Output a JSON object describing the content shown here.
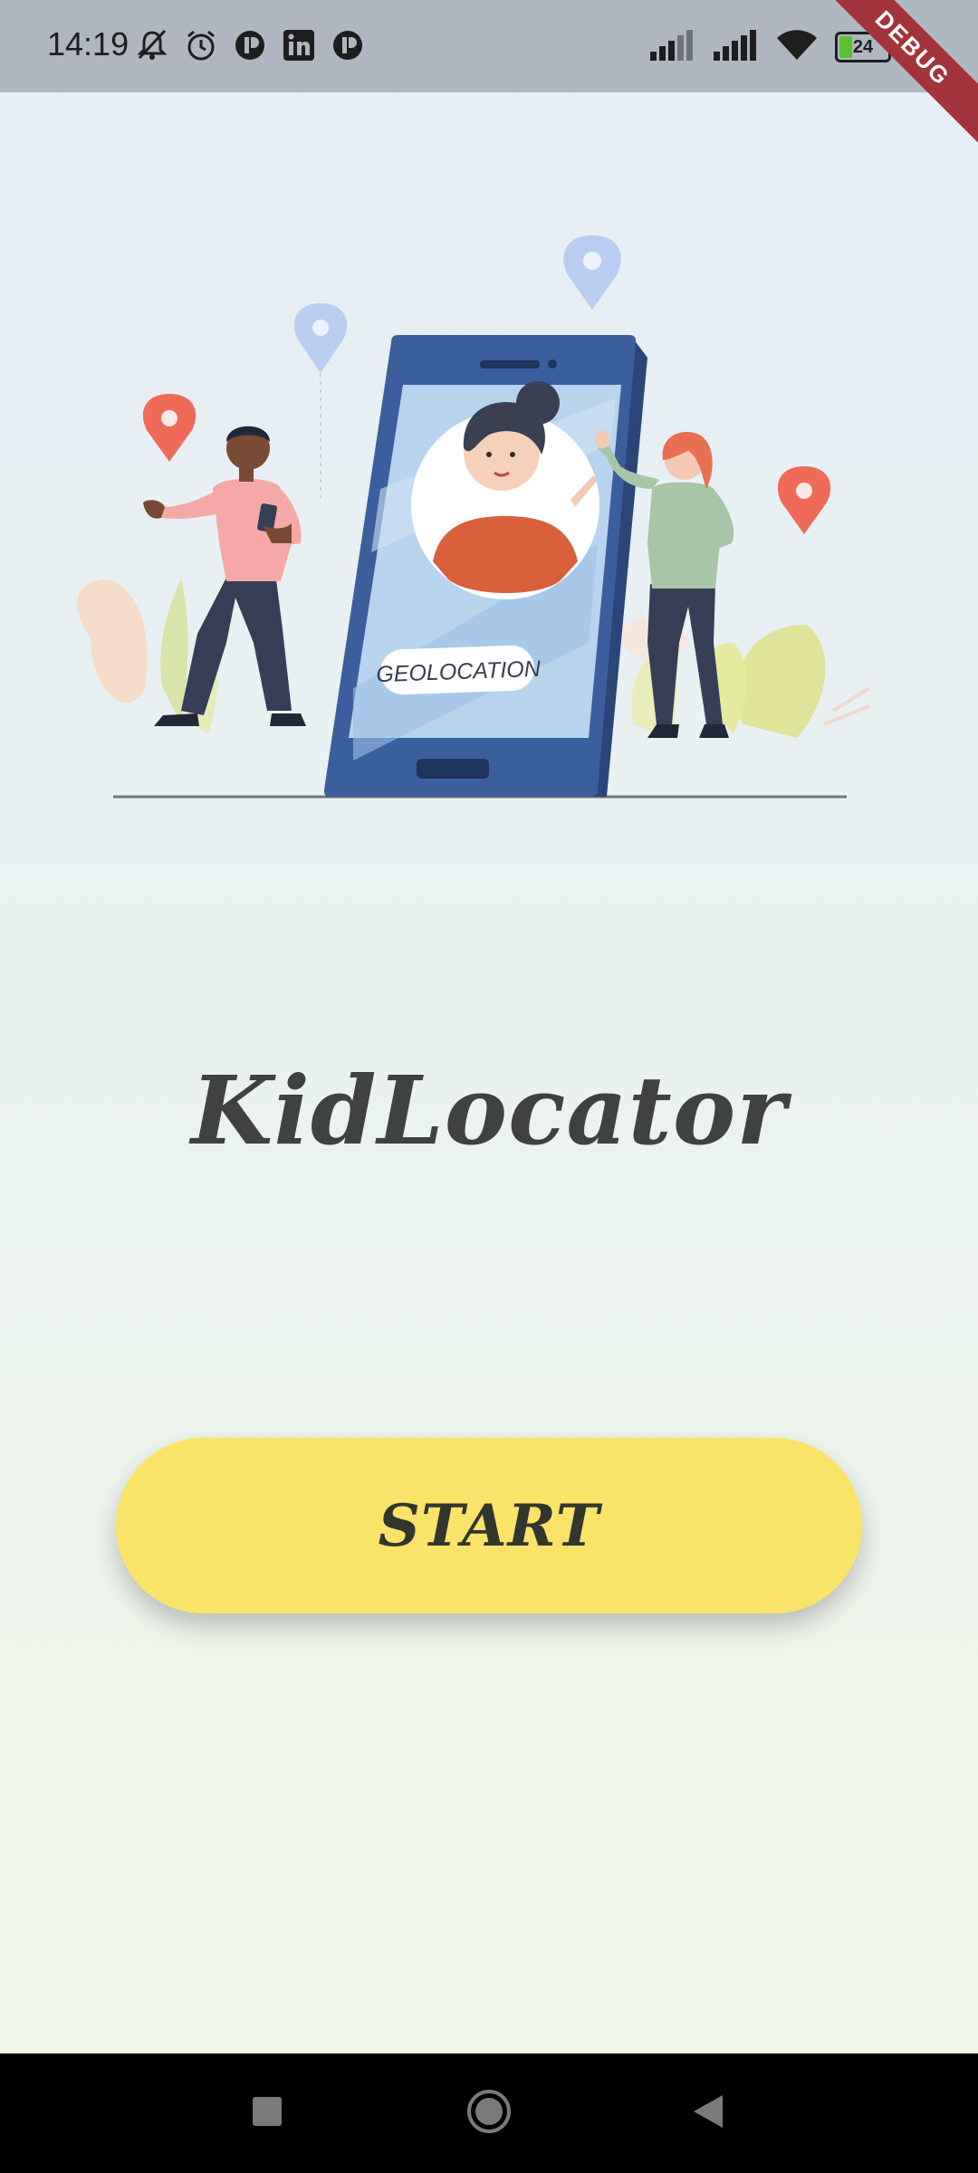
{
  "status_bar": {
    "time": "14:19",
    "left_icons": [
      "mute-icon",
      "alarm-icon",
      "app-icon",
      "linkedin-icon",
      "app-icon"
    ],
    "right_icons": [
      "signal-icon",
      "signal-icon",
      "wifi-icon"
    ],
    "battery_level": "24",
    "debug_label": "DEBUG"
  },
  "hero": {
    "phone_screen_label": "GEOLOCATION"
  },
  "app": {
    "title": "KidLocator",
    "start_label": "START"
  },
  "nav": {
    "buttons": [
      "recent-apps",
      "home",
      "back"
    ]
  },
  "colors": {
    "button": "#fbe36a",
    "title": "#3f4240",
    "pin_red": "#ef6b58",
    "pin_blue": "#b9cdf3",
    "phone": "#3b5f9c"
  }
}
